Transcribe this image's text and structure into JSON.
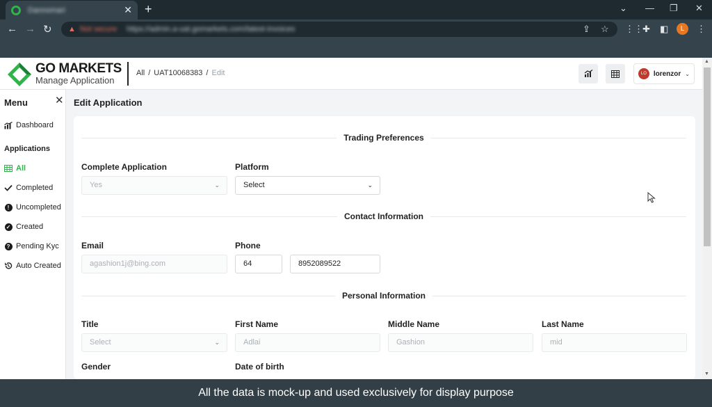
{
  "browser": {
    "tab_title": "Dannomari",
    "address_warning": "Not secure",
    "url": "https://admin.a-uat.gomarkets.com/latest-invoices",
    "profile_initial": "L"
  },
  "header": {
    "logo_title": "GO MARKETS",
    "logo_subtitle": "Manage Application",
    "breadcrumb": [
      "All",
      "UAT10068383",
      "Edit"
    ],
    "user": {
      "initials": "LO",
      "name": "lorenzor"
    }
  },
  "sidebar": {
    "title": "Menu",
    "dashboard": "Dashboard",
    "section": "Applications",
    "items": [
      "All",
      "Completed",
      "Uncompleted",
      "Created",
      "Pending Kyc",
      "Auto Created"
    ]
  },
  "main": {
    "title": "Edit Application",
    "trading": {
      "heading": "Trading Preferences",
      "complete_label": "Complete Application",
      "complete_value": "Yes",
      "platform_label": "Platform",
      "platform_value": "Select"
    },
    "contact": {
      "heading": "Contact Information",
      "email_label": "Email",
      "email_value": "agashion1j@bing.com",
      "phone_label": "Phone",
      "phone_code": "64",
      "phone_number": "8952089522"
    },
    "personal": {
      "heading": "Personal Information",
      "title_label": "Title",
      "title_value": "Select",
      "first_label": "First Name",
      "first_value": "Adlai",
      "middle_label": "Middle Name",
      "middle_value": "Gashion",
      "last_label": "Last Name",
      "last_value": "mid",
      "gender_label": "Gender",
      "dob_label": "Date of birth"
    }
  },
  "caption": "All the data is mock-up and used exclusively for display purpose",
  "colors": {
    "accent": "#2fb34a",
    "chrome": "#35444c",
    "caption_bg": "#333f47"
  }
}
